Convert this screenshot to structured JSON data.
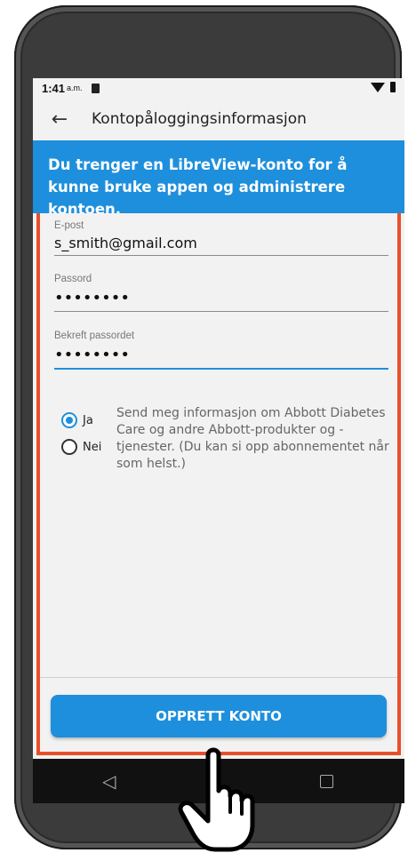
{
  "status_bar": {
    "time": "1:41",
    "ampm": "a.m."
  },
  "app_bar": {
    "title": "Kontopåloggingsinformasjon",
    "back_icon": "arrow-left-icon"
  },
  "banner": {
    "text": "Du trenger en LibreView-konto for å kunne bruke appen og administrere kontoen."
  },
  "form": {
    "email": {
      "label": "E-post",
      "value": "s_smith@gmail.com"
    },
    "password": {
      "label": "Passord",
      "value": "••••••••"
    },
    "confirm_password": {
      "label": "Bekreft passordet",
      "value": "••••••••"
    },
    "consent": {
      "options": [
        {
          "label": "Ja",
          "selected": true
        },
        {
          "label": "Nei",
          "selected": false
        }
      ],
      "text": "Send meg informasjon om Abbott Diabetes Care og andre Abbott-produkter og -tjenester. (Du kan si opp abonnementet når som helst.)"
    }
  },
  "create_button": {
    "label": "OPPRETT KONTO"
  },
  "colors": {
    "accent": "#1e8fdc",
    "highlight": "#e8502a"
  },
  "icons": {
    "pointer": "hand-pointer-icon"
  }
}
